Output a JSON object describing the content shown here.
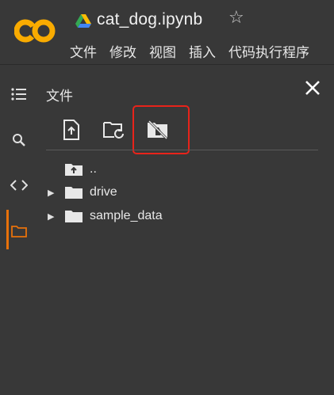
{
  "header": {
    "file_name": "cat_dog.ipynb",
    "star_glyph": "☆",
    "logo_text": "CO",
    "menu": [
      "文件",
      "修改",
      "视图",
      "插入",
      "代码执行程序"
    ]
  },
  "rail": {
    "icons": [
      "table-of-contents-icon",
      "search-icon",
      "code-snippets-icon",
      "folder-icon"
    ],
    "active": "folder-icon",
    "glyphs": {
      "toc": "☰",
      "search": "🔍",
      "code": "<>"
    }
  },
  "panel": {
    "title": "文件",
    "close_glyph": "✕",
    "toolbar": [
      "upload-file-icon",
      "refresh-icon",
      "mount-drive-off-icon"
    ],
    "highlighted": "mount-drive-off-icon"
  },
  "tree": {
    "items": [
      {
        "label": "..",
        "icon": "folder-up-icon",
        "expandable": false
      },
      {
        "label": "drive",
        "icon": "folder-icon",
        "expandable": true
      },
      {
        "label": "sample_data",
        "icon": "folder-icon",
        "expandable": true
      }
    ]
  },
  "colors": {
    "background": "#383838",
    "accent": "#e8710a",
    "highlight": "#e8231a",
    "logo_orange": "#f9ab00"
  }
}
